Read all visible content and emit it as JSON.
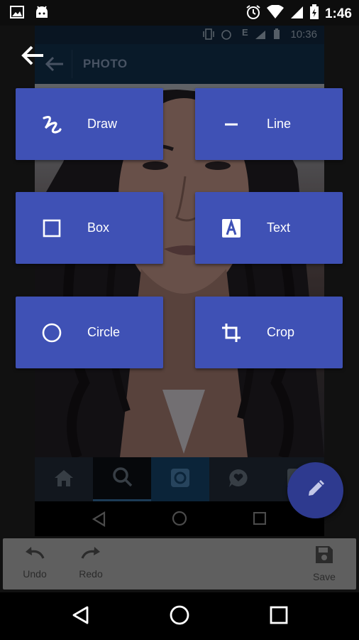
{
  "status_bar": {
    "time": "1:46",
    "icons": [
      "image-icon",
      "android-icon",
      "alarm-icon",
      "wifi-icon",
      "signal-icon",
      "battery-charging-icon"
    ]
  },
  "inner_screenshot": {
    "status_time": "10:36",
    "status_network": "E",
    "appbar_title": "PHOTO",
    "tab_icons": [
      "home-icon",
      "search-icon",
      "camera-icon",
      "heart-bubble-icon",
      "profile-icon"
    ],
    "nav_icons": [
      "back-triangle-icon",
      "home-circle-icon",
      "recents-square-icon"
    ]
  },
  "tools": [
    {
      "id": "draw",
      "label": "Draw",
      "icon": "draw-squiggle-icon"
    },
    {
      "id": "line",
      "label": "Line",
      "icon": "line-icon"
    },
    {
      "id": "box",
      "label": "Box",
      "icon": "square-outline-icon"
    },
    {
      "id": "text",
      "label": "Text",
      "icon": "text-a-icon"
    },
    {
      "id": "circle",
      "label": "Circle",
      "icon": "circle-outline-icon"
    },
    {
      "id": "crop",
      "label": "Crop",
      "icon": "crop-icon"
    }
  ],
  "fab": {
    "icon": "pencil-icon"
  },
  "bottom_toolbar": {
    "undo_label": "Undo",
    "redo_label": "Redo",
    "save_label": "Save"
  },
  "colors": {
    "accent": "#3f51b5",
    "fab": "#2e3a8f",
    "toolbar": "#5f5f5f"
  }
}
